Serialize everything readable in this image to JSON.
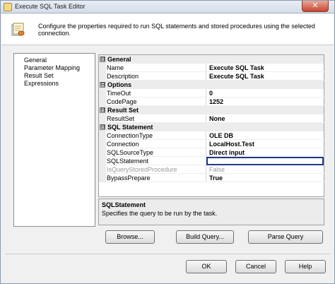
{
  "window": {
    "title": "Execute SQL Task Editor",
    "close_glyph": "✕"
  },
  "header": {
    "description": "Configure the properties required to run SQL statements and stored procedures using the selected connection."
  },
  "nav": {
    "items": [
      "General",
      "Parameter Mapping",
      "Result Set",
      "Expressions"
    ]
  },
  "properties": {
    "general": {
      "label": "General",
      "toggle": "⊟",
      "name": {
        "label": "Name",
        "value": "Execute SQL Task"
      },
      "description": {
        "label": "Description",
        "value": "Execute SQL Task"
      }
    },
    "options": {
      "label": "Options",
      "toggle": "⊟",
      "timeout": {
        "label": "TimeOut",
        "value": "0"
      },
      "codepage": {
        "label": "CodePage",
        "value": "1252"
      }
    },
    "result_set": {
      "label": "Result Set",
      "toggle": "⊟",
      "resultset": {
        "label": "ResultSet",
        "value": "None"
      }
    },
    "sql_statement": {
      "label": "SQL Statement",
      "toggle": "⊟",
      "connection_type": {
        "label": "ConnectionType",
        "value": "OLE DB"
      },
      "connection": {
        "label": "Connection",
        "value": "LocalHost.Test"
      },
      "sql_source_type": {
        "label": "SQLSourceType",
        "value": "Direct input"
      },
      "sql_statement": {
        "label": "SQLStatement",
        "value": ""
      },
      "is_query_stored_procedure": {
        "label": "IsQueryStoredProcedure",
        "value": "False"
      },
      "bypass_prepare": {
        "label": "BypassPrepare",
        "value": "True"
      }
    }
  },
  "description_panel": {
    "title": "SQLStatement",
    "text": "Specifies the query to be run by the task."
  },
  "buttons": {
    "browse": "Browse...",
    "build_query": "Build Query...",
    "parse_query": "Parse Query",
    "ok": "OK",
    "cancel": "Cancel",
    "help": "Help"
  }
}
